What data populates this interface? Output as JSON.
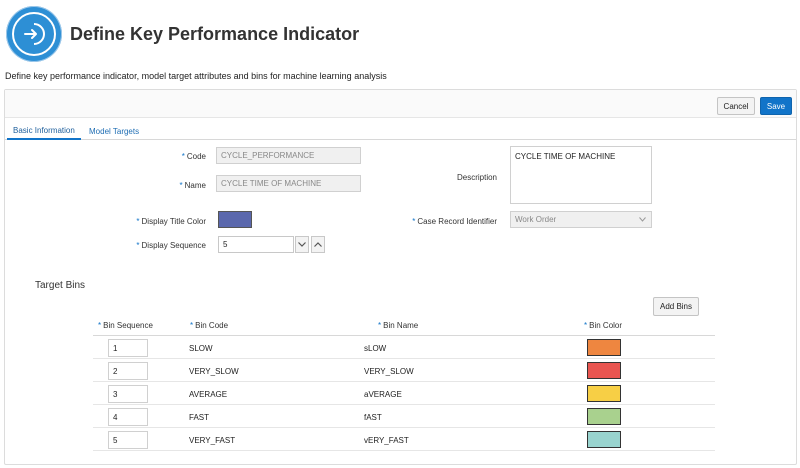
{
  "header": {
    "title": "Define Key Performance Indicator",
    "description": "Define key performance indicator, model target attributes and bins for machine learning analysis",
    "logo_icon": "arrow-into-circle-icon"
  },
  "toolbar": {
    "cancel_label": "Cancel",
    "save_label": "Save"
  },
  "tabs": [
    {
      "label": "Basic Information",
      "active": true
    },
    {
      "label": "Model Targets",
      "active": false
    }
  ],
  "form": {
    "required_marker": "*",
    "code_label": "Code",
    "code_value": "CYCLE_PERFORMANCE",
    "name_label": "Name",
    "name_value": "CYCLE TIME  OF  MACHINE",
    "description_label": "Description",
    "description_value": "CYCLE TIME  OF  MACHINE",
    "display_title_color_label": "Display Title Color",
    "display_title_color": "#5b68ad",
    "case_record_identifier_label": "Case Record Identifier",
    "case_record_identifier_value": "Work Order",
    "display_sequence_label": "Display Sequence",
    "display_sequence_value": "5"
  },
  "target_bins": {
    "title": "Target Bins",
    "add_label": "Add Bins",
    "columns": [
      "Bin Sequence",
      "Bin Code",
      "Bin Name",
      "Bin Color"
    ],
    "rows": [
      {
        "seq": "1",
        "code": "SLOW",
        "name": "sLOW",
        "color": "#ee8640"
      },
      {
        "seq": "2",
        "code": "VERY_SLOW",
        "name": "VERY_SLOW",
        "color": "#e95550"
      },
      {
        "seq": "3",
        "code": "AVERAGE",
        "name": "aVERAGE",
        "color": "#f7cf45"
      },
      {
        "seq": "4",
        "code": "FAST",
        "name": "fAST",
        "color": "#a9d18e"
      },
      {
        "seq": "5",
        "code": "VERY_FAST",
        "name": "vERY_FAST",
        "color": "#99d4cf"
      }
    ]
  },
  "colors": {
    "accent": "#1174c9",
    "logo": "#2d8fd5"
  }
}
